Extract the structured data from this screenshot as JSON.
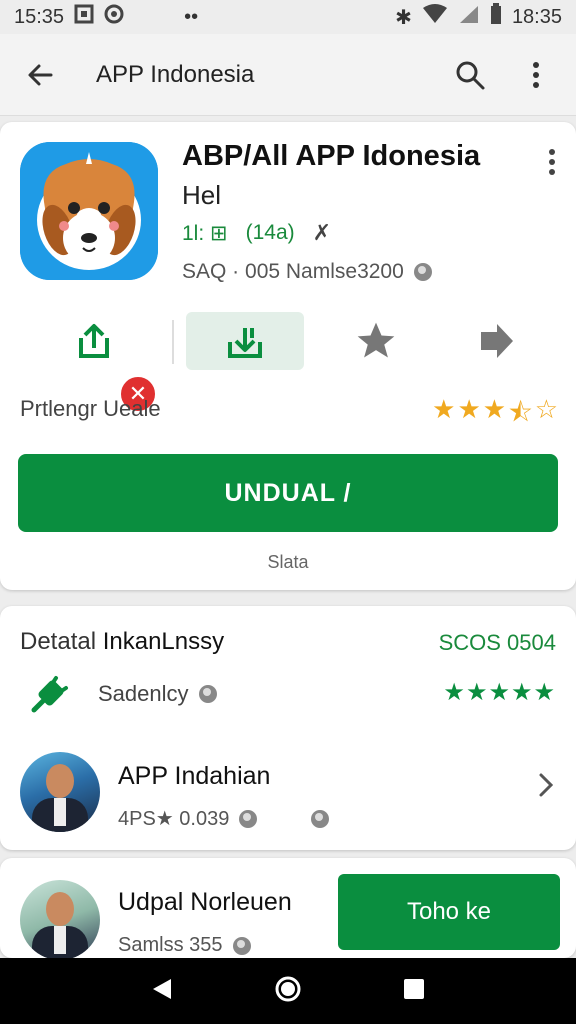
{
  "status_bar": {
    "time_left": "15:35",
    "time_right": "18:35"
  },
  "toolbar": {
    "title": "APP Indonesia"
  },
  "app": {
    "name": "ABP/All APP Idonesia",
    "subtitle": "Hel",
    "meta_left": "1l: ⊞",
    "meta_count": "(14a)",
    "size_text": "SAQ · 005 Namlse3200",
    "badge_symbol": "✕",
    "rating_prompt": "Prtlengr Ueale",
    "install_label": "UNDUAL /",
    "note": "Slata",
    "star_rating": 3.5
  },
  "details": {
    "title_prefix": "Detatal",
    "title_main": "InkanLnssy",
    "code": "SCOS 0504",
    "row_label": "Sadenlcy",
    "stars": "★★★★★",
    "item1_name": "APP Indahian",
    "item1_sub": "4PS★ 0.039"
  },
  "bottom_item": {
    "name": "Udpal Norleuen",
    "sub": "Samlss 355",
    "cta_label": "Toho ke"
  },
  "colors": {
    "brand_green": "#0a8e3f",
    "star_gold": "#f0a920",
    "app_icon_blue": "#1f9be6"
  }
}
